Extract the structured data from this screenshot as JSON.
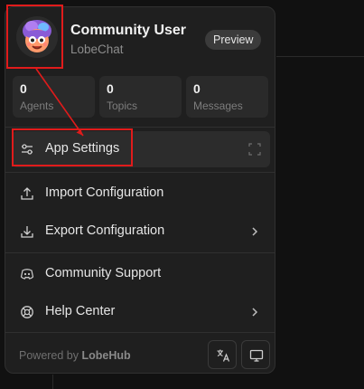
{
  "profile": {
    "name": "Community User",
    "subtitle": "LobeChat",
    "badge": "Preview"
  },
  "stats": [
    {
      "value": "0",
      "label": "Agents"
    },
    {
      "value": "0",
      "label": "Topics"
    },
    {
      "value": "0",
      "label": "Messages"
    }
  ],
  "menu": {
    "app_settings": "App Settings",
    "import_config": "Import Configuration",
    "export_config": "Export Configuration",
    "community_support": "Community Support",
    "help_center": "Help Center"
  },
  "footer": {
    "powered_by": "Powered by",
    "brand": "LobeHub"
  },
  "colors": {
    "annotation": "#e01b1b",
    "panel": "#1f1f1f"
  }
}
